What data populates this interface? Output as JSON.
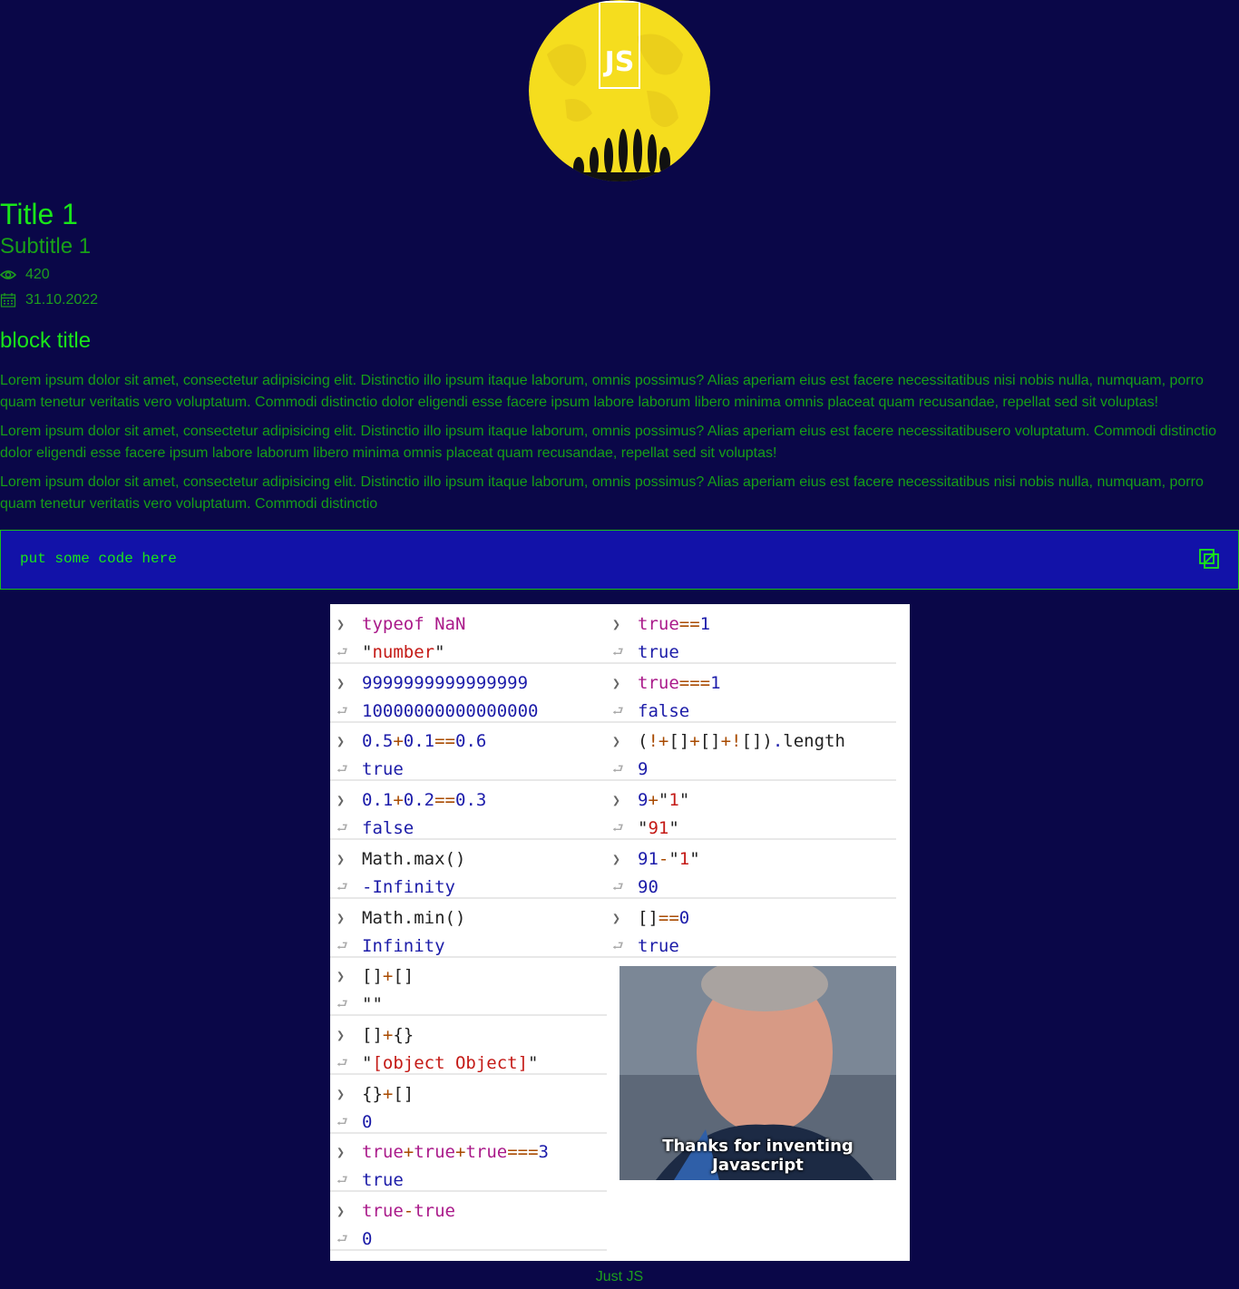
{
  "logo": {
    "text": "JS"
  },
  "header": {
    "title": "Title 1",
    "subtitle": "Subtitle 1",
    "views": "420",
    "date": "31.10.2022"
  },
  "block": {
    "title": "block title",
    "paragraphs": [
      "Lorem ipsum dolor sit amet, consectetur adipisicing elit. Distinctio illo ipsum itaque laborum, omnis possimus? Alias aperiam eius est facere necessitatibus nisi nobis nulla, numquam, porro quam tenetur veritatis vero voluptatum. Commodi distinctio dolor eligendi esse facere ipsum labore laborum libero minima omnis placeat quam recusandae, repellat sed sit voluptas!",
      "Lorem ipsum dolor sit amet, consectetur adipisicing elit. Distinctio illo ipsum itaque laborum, omnis possimus? Alias aperiam eius est facere necessitatibusero voluptatum. Commodi distinctio dolor eligendi esse facere ipsum labore laborum libero minima omnis placeat quam recusandae, repellat sed sit voluptas!",
      "Lorem ipsum dolor sit amet, consectetur adipisicing elit. Distinctio illo ipsum itaque laborum, omnis possimus? Alias aperiam eius est facere necessitatibus nisi nobis nulla, numquam, porro quam tenetur veritatis vero voluptatum. Commodi distinctio"
    ]
  },
  "code_box": {
    "text": "put some code here"
  },
  "console": {
    "left": [
      {
        "in": "typeof NaN",
        "out": "\"number\""
      },
      {
        "in": "9999999999999999",
        "out": "10000000000000000"
      },
      {
        "in": "0.5+0.1==0.6",
        "out": "true"
      },
      {
        "in": "0.1+0.2==0.3",
        "out": "false"
      },
      {
        "in": "Math.max()",
        "out": "-Infinity"
      },
      {
        "in": "Math.min()",
        "out": "Infinity"
      },
      {
        "in": "[]+[]",
        "out": "\"\""
      },
      {
        "in": "[]+{}",
        "out": "\"[object Object]\""
      },
      {
        "in": "{}+[]",
        "out": "0"
      },
      {
        "in": "true+true+true===3",
        "out": "true"
      },
      {
        "in": "true-true",
        "out": "0"
      }
    ],
    "right": [
      {
        "in": "true==1",
        "out": "true"
      },
      {
        "in": "true===1",
        "out": "false"
      },
      {
        "in": "(!+[]+[]+![]).length",
        "out": "9"
      },
      {
        "in": "9+\"1\"",
        "out": "\"91\""
      },
      {
        "in": "91-\"1\"",
        "out": "90"
      },
      {
        "in": "[]==0",
        "out": "true"
      }
    ],
    "meme_caption": "Thanks for inventing Javascript"
  },
  "footer": {
    "text": "Just JS"
  }
}
